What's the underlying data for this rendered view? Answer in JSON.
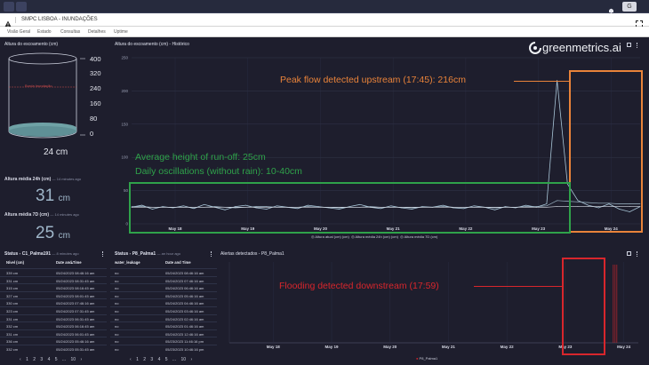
{
  "topbar": {
    "user_label": "G"
  },
  "title": "SMPC LISBOA - INUNDAÇÕES",
  "tabs": [
    "Visão Geral",
    "Estado",
    "Consultas",
    "Detalhes",
    "Uptime"
  ],
  "brand": {
    "name": "greenmetrics.ai"
  },
  "left_panel": {
    "title": "Altura do escoamento (cm)",
    "gauge_ticks": [
      "400",
      "320",
      "240",
      "160",
      "80",
      "0"
    ],
    "overlay_text": "Borda Inundação",
    "value": "24 cm",
    "avg24": {
      "label": "Altura média 24h (cm)",
      "ago": "— 14 minutes ago",
      "value": "31",
      "unit": "cm"
    },
    "avg7d": {
      "label": "Altura média 7D (cm)",
      "ago": "— 14 minutes ago",
      "value": "25",
      "unit": "cm"
    }
  },
  "history_chart": {
    "title": "Altura do escoamento (cm) - Histórico",
    "y_ticks": [
      "250",
      "200",
      "150",
      "100",
      "50",
      "0"
    ],
    "x_ticks": [
      "May 18",
      "May 19",
      "May 20",
      "May 21",
      "May 22",
      "May 23",
      "May 24"
    ],
    "legend": [
      "Altura atual (cm) (cm)",
      "Altura média 24h (cm) (cm)",
      "Altura média 7D (cm)"
    ]
  },
  "chart_data": [
    {
      "type": "line",
      "title": "Altura do escoamento (cm) - Histórico",
      "x": [
        "May 18",
        "May 19",
        "May 20",
        "May 21",
        "May 22",
        "May 23",
        "May 24"
      ],
      "ylim": [
        0,
        250
      ],
      "series": [
        {
          "name": "Altura atual (cm) (cm)",
          "values": [
            25,
            28,
            22,
            26,
            24,
            27,
            23,
            29,
            25,
            21,
            26,
            28,
            24,
            22,
            27,
            25,
            23,
            28,
            26,
            24,
            22,
            26,
            29,
            25,
            23,
            27,
            24,
            22,
            26,
            25,
            28,
            24,
            23,
            27,
            25,
            21,
            26,
            24,
            28,
            25,
            30,
            216,
            60,
            35,
            28,
            24,
            30,
            22,
            18,
            26
          ]
        },
        {
          "name": "Altura média 24h (cm) (cm)",
          "values": [
            26,
            26,
            25,
            25,
            25,
            25,
            25,
            25,
            26,
            25,
            24,
            25,
            26,
            26,
            25,
            25,
            25,
            26,
            25,
            25,
            24,
            25,
            25,
            26,
            25,
            25,
            25,
            24,
            25,
            25,
            26,
            25,
            25,
            25,
            25,
            24,
            25,
            25,
            26,
            26,
            27,
            35,
            34,
            33,
            32,
            31,
            31,
            30,
            30,
            30
          ]
        },
        {
          "name": "Altura média 7D (cm)",
          "values": [
            25,
            25,
            25,
            25,
            25,
            25,
            25,
            25,
            25,
            25,
            25,
            25,
            25,
            25,
            25,
            25,
            25,
            25,
            25,
            25,
            25,
            25,
            25,
            25,
            25,
            25,
            25,
            25,
            25,
            25,
            25,
            25,
            25,
            25,
            25,
            25,
            25,
            25,
            25,
            25,
            25,
            26,
            26,
            26,
            26,
            26,
            26,
            26,
            26,
            26
          ]
        }
      ]
    },
    {
      "type": "line",
      "title": "Alertas detectados - P8_Palma1",
      "x": [
        "May 18",
        "May 19",
        "May 20",
        "May 21",
        "May 22",
        "May 23",
        "May 24"
      ],
      "series": [
        {
          "name": "P8_Palma1",
          "events": [
            "May 23 17:59"
          ]
        }
      ]
    }
  ],
  "annotations": {
    "peak": "Peak flow detected upstream (17:45): 216cm",
    "avg": "Average height of run-off: 25cm",
    "oscillations": "Daily oscillations (without rain): 10-40cm",
    "flooding": "Flooding detected downstream (17:59)"
  },
  "table1": {
    "title": "Status - C1_Palma191",
    "ago": "— 8 minutes ago",
    "headers": [
      "Nível (cm)",
      "Date and Time"
    ],
    "rows": [
      [
        "339 cm",
        "05/24/2023 08:46:16 am"
      ],
      [
        "331 cm",
        "05/24/2023 08:31:45 am"
      ],
      [
        "315 cm",
        "05/24/2023 08:16:45 am"
      ],
      [
        "327 cm",
        "05/24/2023 08:01:45 am"
      ],
      [
        "330 cm",
        "05/24/2023 07:46:16 am"
      ],
      [
        "323 cm",
        "05/24/2023 07:31:45 am"
      ],
      [
        "331 cm",
        "05/24/2023 06:31:45 am"
      ],
      [
        "332 cm",
        "05/24/2023 06:16:45 am"
      ],
      [
        "331 cm",
        "05/24/2023 06:01:45 am"
      ],
      [
        "336 cm",
        "05/24/2023 05:46:16 am"
      ],
      [
        "332 cm",
        "05/24/2023 05:31:45 am"
      ]
    ],
    "pager": [
      "‹",
      "1",
      "2",
      "3",
      "4",
      "5",
      "...",
      "10",
      "›"
    ]
  },
  "table2": {
    "title": "Status - P8_Palma1",
    "ago": "— an hour ago",
    "headers": [
      "water_leakage",
      "Date and Time"
    ],
    "rows": [
      [
        "no",
        "05/24/2023 08:46:16 am"
      ],
      [
        "no",
        "05/24/2023 07:46:16 am"
      ],
      [
        "no",
        "05/24/2023 06:46:16 am"
      ],
      [
        "no",
        "05/24/2023 05:46:16 am"
      ],
      [
        "no",
        "05/24/2023 04:46:16 am"
      ],
      [
        "no",
        "05/24/2023 03:46:16 am"
      ],
      [
        "no",
        "05/24/2023 02:46:16 am"
      ],
      [
        "no",
        "05/24/2023 01:46:16 am"
      ],
      [
        "no",
        "05/24/2023 12:46:16 am"
      ],
      [
        "no",
        "05/23/2023 11:46:16 pm"
      ],
      [
        "no",
        "05/23/2023 10:46:16 pm"
      ]
    ],
    "pager": [
      "‹",
      "1",
      "2",
      "3",
      "4",
      "5",
      "...",
      "10",
      "›"
    ]
  },
  "alerts_chart": {
    "title": "Alertas detectados - P8_Palma1",
    "x_ticks": [
      "May 18",
      "May 19",
      "May 20",
      "May 21",
      "May 22",
      "May 23",
      "May 24"
    ],
    "legend": "P8_Palma1"
  },
  "colors": {
    "background": "#1e1e2d",
    "line": "#a9c6d8",
    "orange": "#e9833a",
    "green": "#2fa24a",
    "red": "#d8262c"
  }
}
